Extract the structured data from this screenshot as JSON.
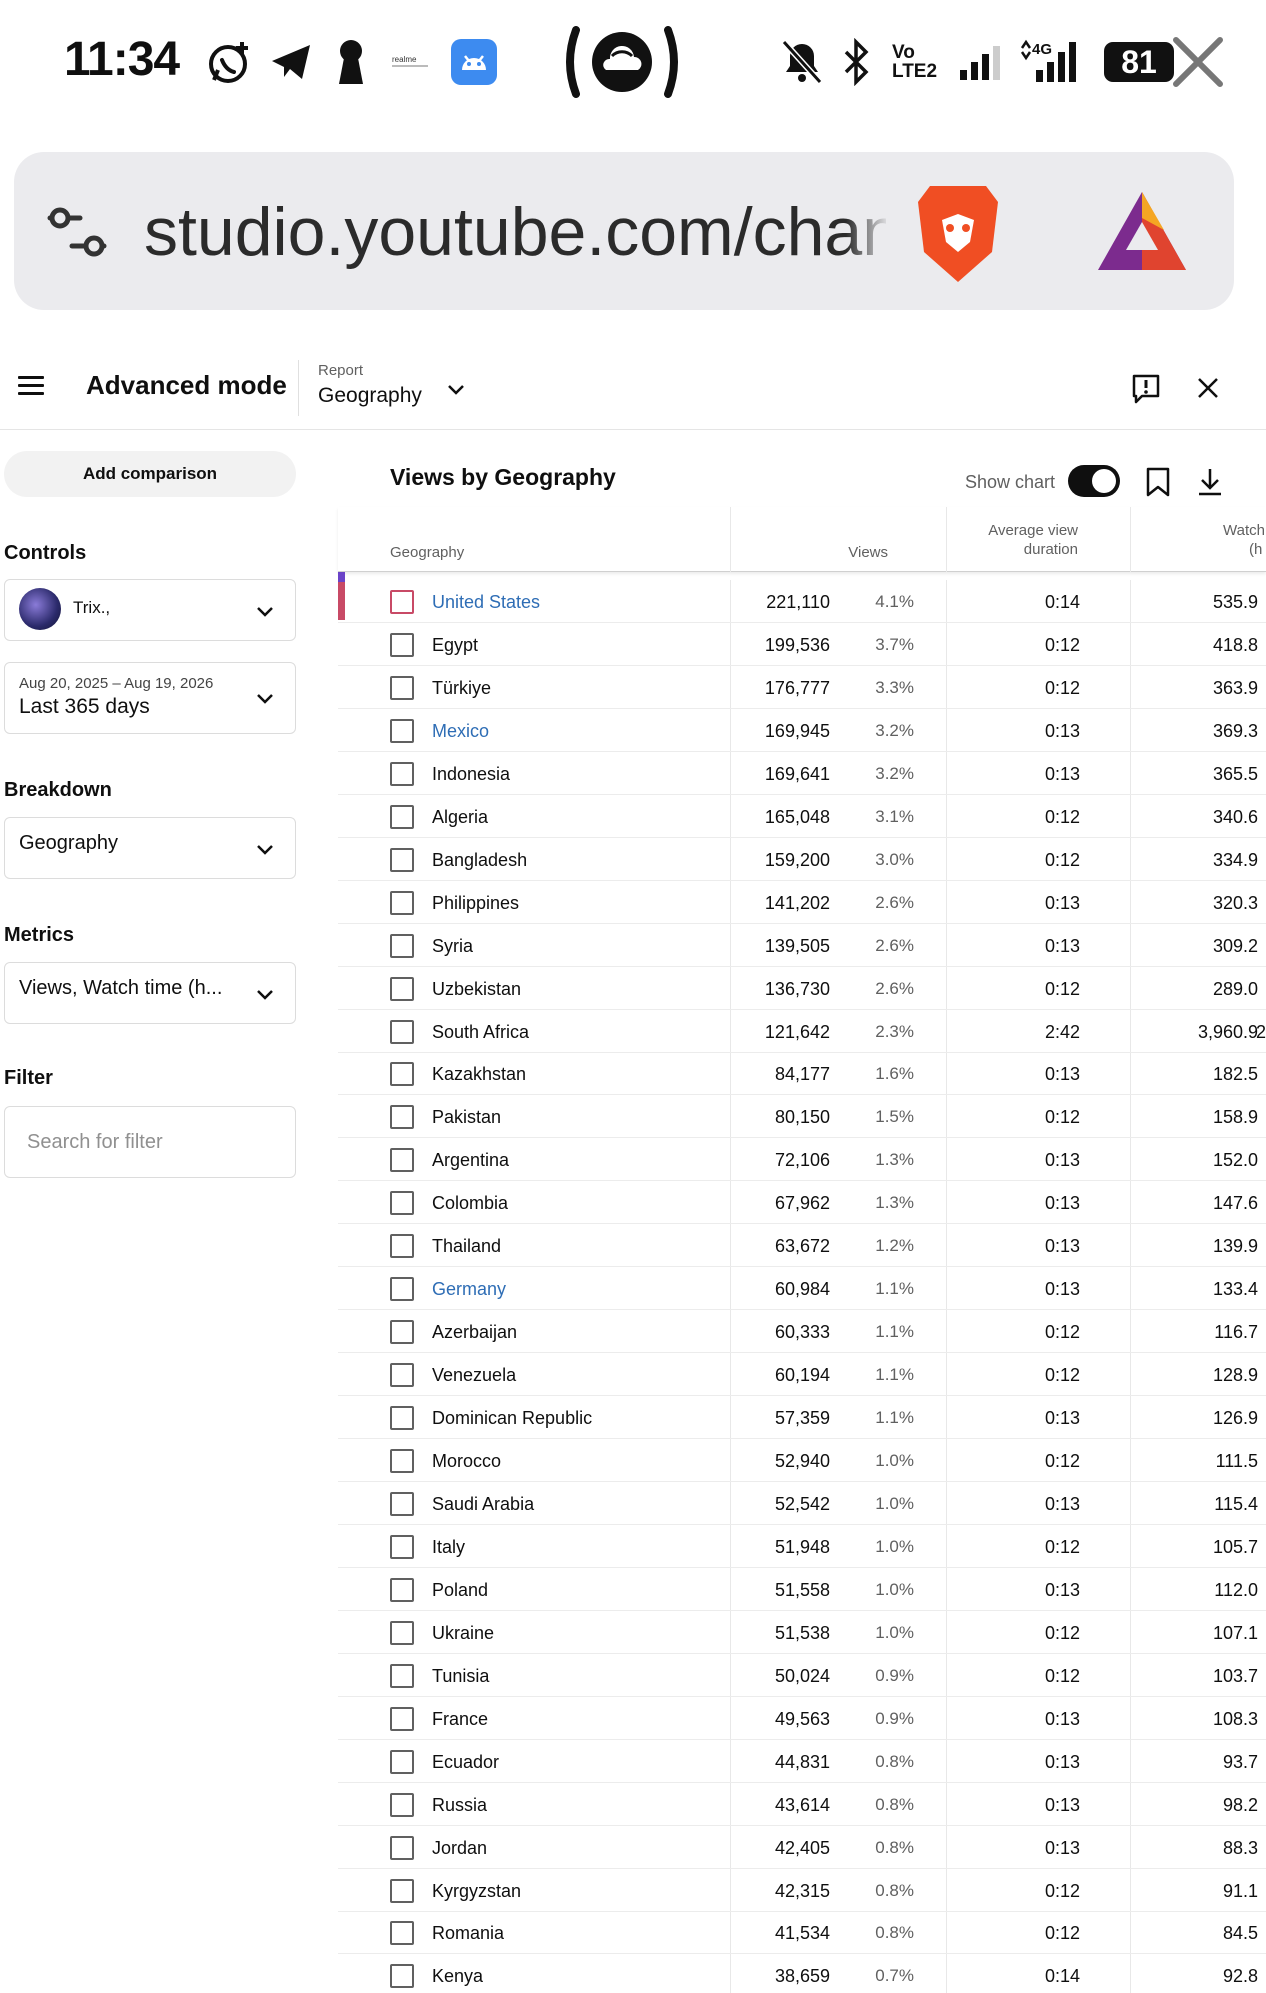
{
  "status_bar": {
    "time": "11:34",
    "battery": "81",
    "icons": [
      "whatsapp-icon",
      "telegram-icon",
      "keyhole-icon",
      "realme-icon",
      "android-icon",
      "hotspot-icon",
      "mute-icon",
      "bluetooth-icon",
      "volte-icon",
      "signal-icon",
      "4g-signal-icon",
      "close-icon"
    ],
    "network_label": "4G",
    "volte_label": "Vo LTE2"
  },
  "browser": {
    "url": "studio.youtube.com/channel",
    "colors": {
      "brave": "#f04e23",
      "bat": "#7c2b8e"
    }
  },
  "header": {
    "title": "Advanced mode",
    "report_label": "Report",
    "report_value": "Geography"
  },
  "left_panel": {
    "add_comparison": "Add comparison",
    "controls_label": "Controls",
    "channel_name": "Trix.,",
    "date_range": "Aug 20, 2025 – Aug 19, 2026",
    "date_label": "Last 365 days",
    "breakdown_label": "Breakdown",
    "breakdown_value": "Geography",
    "metrics_label": "Metrics",
    "metrics_value": "Views, Watch time (h...",
    "filter_label": "Filter",
    "filter_placeholder": "Search for filter"
  },
  "table": {
    "title": "Views by Geography",
    "show_chart_label": "Show chart",
    "show_chart_on": true,
    "headers": {
      "geography": "Geography",
      "views": "Views",
      "avd_line1": "Average view",
      "avd_line2": "duration",
      "watch_line1": "Watch",
      "watch_line2": "(h"
    },
    "rows": [
      {
        "name": "United States",
        "views": "221,110",
        "pct": "4.1%",
        "avd": "0:14",
        "watch": "535.9",
        "link": true,
        "red": true,
        "bar": "#c84a66"
      },
      {
        "name": "Egypt",
        "views": "199,536",
        "pct": "3.7%",
        "avd": "0:12",
        "watch": "418.8"
      },
      {
        "name": "Türkiye",
        "views": "176,777",
        "pct": "3.3%",
        "avd": "0:12",
        "watch": "363.9"
      },
      {
        "name": "Mexico",
        "views": "169,945",
        "pct": "3.2%",
        "avd": "0:13",
        "watch": "369.3",
        "link": true
      },
      {
        "name": "Indonesia",
        "views": "169,641",
        "pct": "3.2%",
        "avd": "0:13",
        "watch": "365.5"
      },
      {
        "name": "Algeria",
        "views": "165,048",
        "pct": "3.1%",
        "avd": "0:12",
        "watch": "340.6"
      },
      {
        "name": "Bangladesh",
        "views": "159,200",
        "pct": "3.0%",
        "avd": "0:12",
        "watch": "334.9"
      },
      {
        "name": "Philippines",
        "views": "141,202",
        "pct": "2.6%",
        "avd": "0:13",
        "watch": "320.3"
      },
      {
        "name": "Syria",
        "views": "139,505",
        "pct": "2.6%",
        "avd": "0:13",
        "watch": "309.2"
      },
      {
        "name": "Uzbekistan",
        "views": "136,730",
        "pct": "2.6%",
        "avd": "0:12",
        "watch": "289.0"
      },
      {
        "name": "South Africa",
        "views": "121,642",
        "pct": "2.3%",
        "avd": "2:42",
        "watch": "3,960.9",
        "extra": "2"
      },
      {
        "name": "Kazakhstan",
        "views": "84,177",
        "pct": "1.6%",
        "avd": "0:13",
        "watch": "182.5"
      },
      {
        "name": "Pakistan",
        "views": "80,150",
        "pct": "1.5%",
        "avd": "0:12",
        "watch": "158.9"
      },
      {
        "name": "Argentina",
        "views": "72,106",
        "pct": "1.3%",
        "avd": "0:13",
        "watch": "152.0"
      },
      {
        "name": "Colombia",
        "views": "67,962",
        "pct": "1.3%",
        "avd": "0:13",
        "watch": "147.6"
      },
      {
        "name": "Thailand",
        "views": "63,672",
        "pct": "1.2%",
        "avd": "0:13",
        "watch": "139.9"
      },
      {
        "name": "Germany",
        "views": "60,984",
        "pct": "1.1%",
        "avd": "0:13",
        "watch": "133.4",
        "link": true
      },
      {
        "name": "Azerbaijan",
        "views": "60,333",
        "pct": "1.1%",
        "avd": "0:12",
        "watch": "116.7"
      },
      {
        "name": "Venezuela",
        "views": "60,194",
        "pct": "1.1%",
        "avd": "0:12",
        "watch": "128.9"
      },
      {
        "name": "Dominican Republic",
        "views": "57,359",
        "pct": "1.1%",
        "avd": "0:13",
        "watch": "126.9"
      },
      {
        "name": "Morocco",
        "views": "52,940",
        "pct": "1.0%",
        "avd": "0:12",
        "watch": "111.5"
      },
      {
        "name": "Saudi Arabia",
        "views": "52,542",
        "pct": "1.0%",
        "avd": "0:13",
        "watch": "115.4"
      },
      {
        "name": "Italy",
        "views": "51,948",
        "pct": "1.0%",
        "avd": "0:12",
        "watch": "105.7"
      },
      {
        "name": "Poland",
        "views": "51,558",
        "pct": "1.0%",
        "avd": "0:13",
        "watch": "112.0"
      },
      {
        "name": "Ukraine",
        "views": "51,538",
        "pct": "1.0%",
        "avd": "0:12",
        "watch": "107.1"
      },
      {
        "name": "Tunisia",
        "views": "50,024",
        "pct": "0.9%",
        "avd": "0:12",
        "watch": "103.7"
      },
      {
        "name": "France",
        "views": "49,563",
        "pct": "0.9%",
        "avd": "0:13",
        "watch": "108.3"
      },
      {
        "name": "Ecuador",
        "views": "44,831",
        "pct": "0.8%",
        "avd": "0:13",
        "watch": "93.7"
      },
      {
        "name": "Russia",
        "views": "43,614",
        "pct": "0.8%",
        "avd": "0:13",
        "watch": "98.2"
      },
      {
        "name": "Jordan",
        "views": "42,405",
        "pct": "0.8%",
        "avd": "0:13",
        "watch": "88.3"
      },
      {
        "name": "Kyrgyzstan",
        "views": "42,315",
        "pct": "0.8%",
        "avd": "0:12",
        "watch": "91.1"
      },
      {
        "name": "Romania",
        "views": "41,534",
        "pct": "0.8%",
        "avd": "0:12",
        "watch": "84.5"
      },
      {
        "name": "Kenya",
        "views": "38,659",
        "pct": "0.7%",
        "avd": "0:14",
        "watch": "92.8"
      }
    ]
  }
}
